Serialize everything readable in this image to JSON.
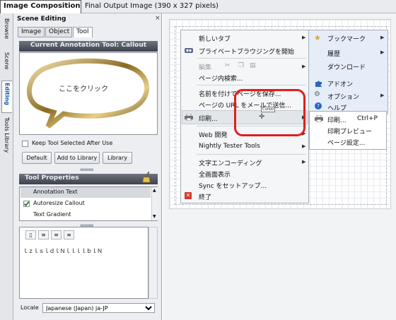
{
  "top_tabs": {
    "active": "Image Composition",
    "inactive": "Final Output Image (390 x 327 pixels)"
  },
  "vertical_tabs": [
    "Browse",
    "Scene",
    "Editing",
    "Tools Library"
  ],
  "scene_panel": {
    "title": "Scene Editing",
    "close_glyph": "×",
    "tabs": [
      "Image",
      "Object",
      "Tool"
    ],
    "annotation_header": "Current Annotation Tool: Callout",
    "callout_text": "ここをクリック",
    "keep_tool_label": "Keep Tool Selected After Use",
    "buttons": [
      "Default",
      "Add to Library",
      "Library"
    ],
    "tool_properties_header": "Tool Properties",
    "properties": [
      {
        "label": "Annotation Text",
        "checked": false,
        "selected": true
      },
      {
        "label": "Autoresize Callout",
        "checked": true,
        "selected": false
      },
      {
        "label": "Text Gradient",
        "checked": false,
        "selected": false
      }
    ],
    "editor_text": "ｌｚｌｓｌｄｌＮｌｌｌｌｂｌＮ",
    "locale_label": "Locale",
    "locale_value": "Japanese (Japan) ja-JP"
  },
  "browser_menu": {
    "items": [
      {
        "label": "新しいタブ",
        "arrow": true,
        "disabled": false
      },
      {
        "label": "プライベートブラウジングを開始",
        "arrow": false,
        "disabled": false
      },
      {
        "label": "編集",
        "arrow": true,
        "disabled": true
      },
      {
        "label": "ページ内検索...",
        "arrow": false,
        "disabled": false
      },
      {
        "label": "名前を付けてページを保存...",
        "arrow": false,
        "disabled": false
      },
      {
        "label": "ページの URL をメールで送信...",
        "arrow": false,
        "disabled": false
      },
      {
        "label": "印刷...",
        "arrow": true,
        "disabled": false
      },
      {
        "label": "Web 開発",
        "arrow": true,
        "disabled": false
      },
      {
        "label": "Nightly Tester Tools",
        "arrow": true,
        "disabled": false
      },
      {
        "label": "文字エンコーディング",
        "arrow": true,
        "disabled": false
      },
      {
        "label": "全画面表示",
        "arrow": false,
        "disabled": false
      },
      {
        "label": "Sync をセットアップ...",
        "arrow": false,
        "disabled": false
      },
      {
        "label": "終了",
        "arrow": false,
        "disabled": false
      }
    ],
    "side_items": [
      {
        "label": "ブックマーク",
        "arrow": true
      },
      {
        "label": "履歴",
        "arrow": true
      },
      {
        "label": "ダウンロード",
        "arrow": false
      },
      {
        "label": "アドオン",
        "arrow": false
      },
      {
        "label": "オプション",
        "arrow": true
      },
      {
        "label": "ヘルプ",
        "arrow": true
      }
    ],
    "print_submenu": [
      {
        "label": "印刷...",
        "shortcut": "Ctrl+P"
      },
      {
        "label": "印刷プレビュー",
        "shortcut": ""
      },
      {
        "label": "ページ設定...",
        "shortcut": ""
      }
    ],
    "cursor_label": "Cursor"
  },
  "colors": {
    "highlight_rect": "#e01f1f",
    "sidebar_bg": "#e4edf8",
    "header_dark": "#3d424b"
  },
  "icons": [
    "close-icon",
    "broom-icon",
    "checkbox-checked-icon",
    "incognito-icon",
    "scissors-icon",
    "copy-icon",
    "paste-icon",
    "printer-icon",
    "exit-icon",
    "star-icon",
    "puzzle-icon",
    "gear-icon",
    "help-icon",
    "cursor-icon"
  ]
}
